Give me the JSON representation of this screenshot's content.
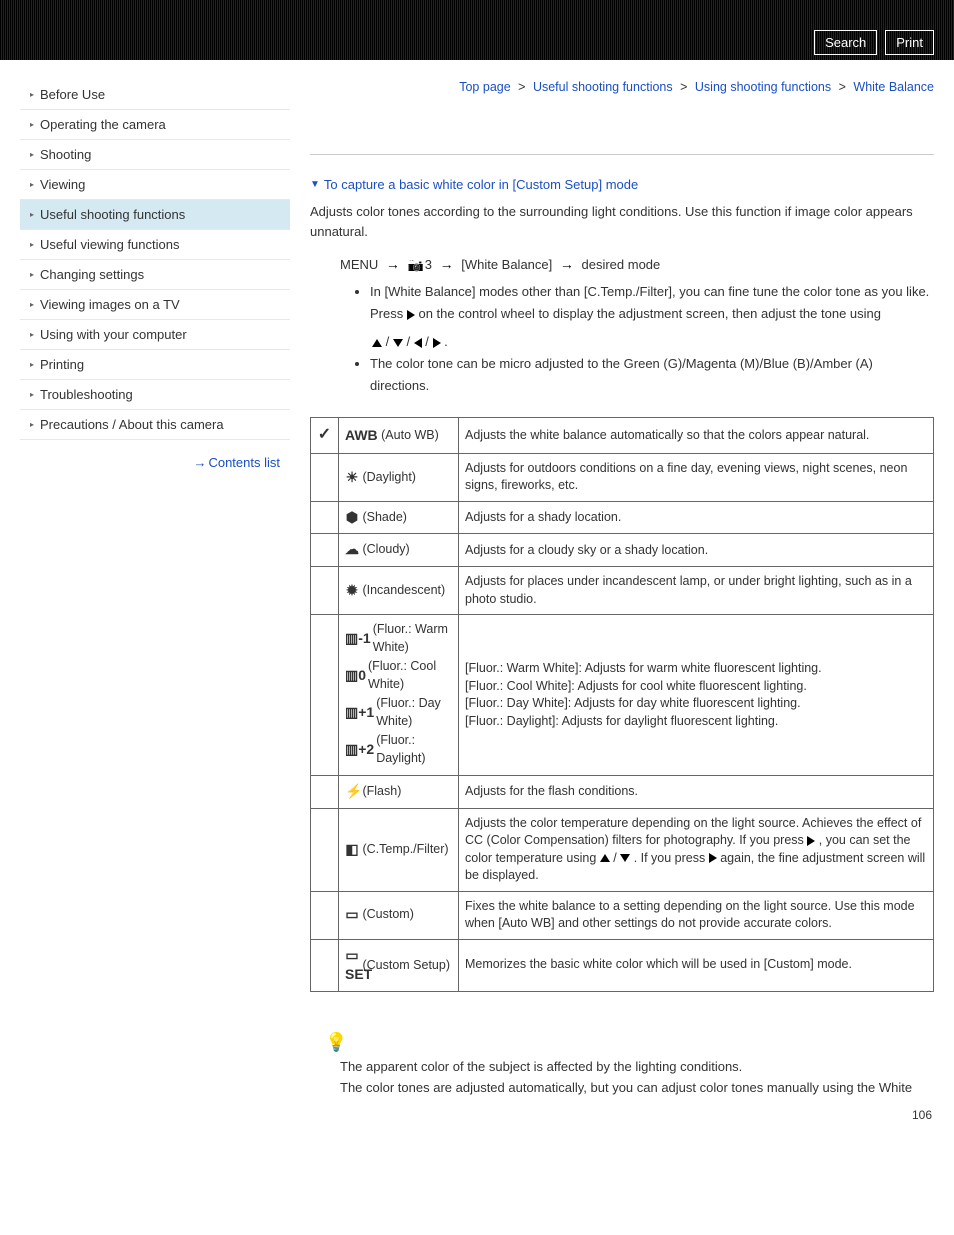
{
  "header": {
    "search": "Search",
    "print": "Print"
  },
  "breadcrumb": {
    "top": "Top page",
    "lvl1": "Useful shooting functions",
    "lvl2": "Using shooting functions",
    "current": "White Balance",
    "sep": ">"
  },
  "anchor": "To capture a basic white color in [Custom Setup] mode",
  "intro": "Adjusts color tones according to the surrounding light conditions. Use this function if image color appears unnatural.",
  "menu_path": {
    "menu": "MENU",
    "num": "3",
    "item": "[White Balance]",
    "end": "desired mode"
  },
  "bullet1": "In [White Balance] modes other than [C.Temp./Filter], you can fine tune the color tone as you like. Press",
  "bullet1b": "on the control wheel to display the adjustment screen, then adjust the tone using",
  "bullet2": "The color tone can be micro adjusted to the Green (G)/Magenta (M)/Blue (B)/Amber (A) directions.",
  "rows": [
    {
      "label": "(Auto WB)",
      "prefix": "AWB",
      "desc": "Adjusts the white balance automatically so that the colors appear natural.",
      "check": true
    },
    {
      "label": "(Daylight)",
      "icon": "☀",
      "desc": "Adjusts for outdoors conditions on a fine day, evening views, night scenes, neon signs, fireworks, etc."
    },
    {
      "label": "(Shade)",
      "icon": "⬢",
      "desc": "Adjusts for a shady location."
    },
    {
      "label": "(Cloudy)",
      "icon": "☁",
      "desc": "Adjusts for a cloudy sky or a shady location."
    },
    {
      "label": "(Incandescent)",
      "icon": "✹",
      "desc": "Adjusts for places under incandescent lamp, or under bright lighting, such as in a photo studio."
    },
    {
      "labels": [
        {
          "icon": "▥-1",
          "text": "(Fluor.: Warm White)"
        },
        {
          "icon": "▥0",
          "text": "(Fluor.: Cool White)"
        },
        {
          "icon": "▥+1",
          "text": "(Fluor.: Day White)"
        },
        {
          "icon": "▥+2",
          "text": "(Fluor.: Daylight)"
        }
      ],
      "desc_lines": [
        "[Fluor.: Warm White]: Adjusts for warm white fluorescent lighting.",
        "[Fluor.: Cool White]: Adjusts for cool white fluorescent lighting.",
        "[Fluor.: Day White]: Adjusts for day white fluorescent lighting.",
        "[Fluor.: Daylight]: Adjusts for daylight fluorescent lighting."
      ]
    },
    {
      "label": "(Flash)",
      "icon": "⚡",
      "desc": "Adjusts for the flash conditions."
    },
    {
      "label": "(C.Temp./Filter)",
      "icon": "◧",
      "desc_pre": "Adjusts the color temperature depending on the light source. Achieves the effect of CC (Color Compensation) filters for photography. If you press",
      "desc_mid1": ", you can set the color temperature using",
      "desc_mid2": ". If you press",
      "desc_post": "again, the fine adjustment screen will be displayed."
    },
    {
      "label": "(Custom)",
      "icon": "▭",
      "desc": "Fixes the white balance to a setting depending on the light source. Use this mode when [Auto WB] and other settings do not provide accurate colors."
    },
    {
      "label": "(Custom Setup)",
      "icon": "▭ SET",
      "desc": "Memorizes the basic white color which will be used in [Custom] mode."
    }
  ],
  "tip1": "The apparent color of the subject is affected by the lighting conditions.",
  "tip2": "The color tones are adjusted automatically, but you can adjust color tones manually using the White",
  "sidebar": [
    "Before Use",
    "Operating the camera",
    "Shooting",
    "Viewing",
    "Useful shooting functions",
    "Useful viewing functions",
    "Changing settings",
    "Viewing images on a TV",
    "Using with your computer",
    "Printing",
    "Troubleshooting",
    "Precautions / About this camera"
  ],
  "contents_list": "Contents list",
  "pagenum": "106"
}
